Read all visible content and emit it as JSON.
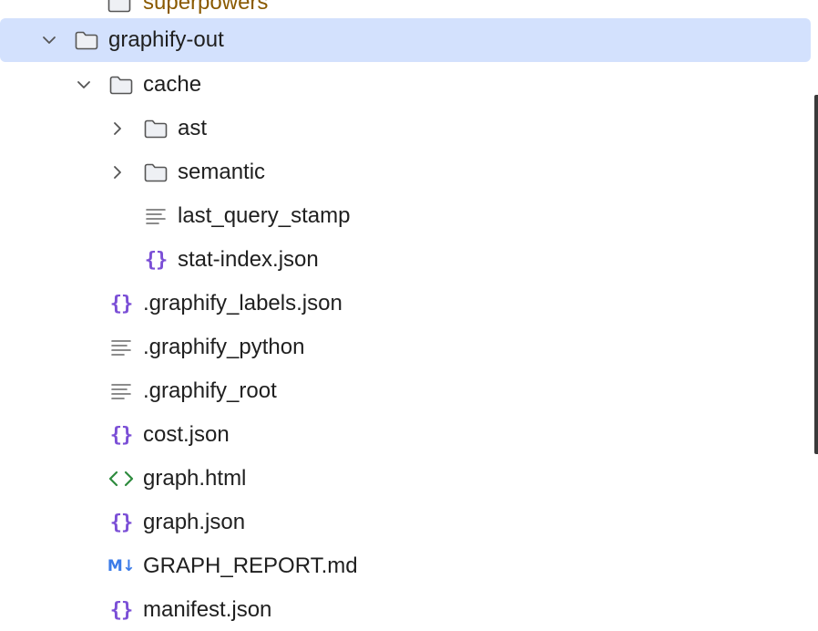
{
  "tree": {
    "items": [
      {
        "label": "superpowers",
        "kind": "folder",
        "expanded": false,
        "status": "modified"
      },
      {
        "label": "graphify-out",
        "kind": "folder",
        "expanded": true,
        "selected": true
      },
      {
        "label": "cache",
        "kind": "folder",
        "expanded": true
      },
      {
        "label": "ast",
        "kind": "folder",
        "expanded": false
      },
      {
        "label": "semantic",
        "kind": "folder",
        "expanded": false
      },
      {
        "label": "last_query_stamp",
        "kind": "text-file"
      },
      {
        "label": "stat-index.json",
        "kind": "json-file"
      },
      {
        "label": ".graphify_labels.json",
        "kind": "json-file"
      },
      {
        "label": ".graphify_python",
        "kind": "text-file"
      },
      {
        "label": ".graphify_root",
        "kind": "text-file"
      },
      {
        "label": "cost.json",
        "kind": "json-file"
      },
      {
        "label": "graph.html",
        "kind": "html-file"
      },
      {
        "label": "graph.json",
        "kind": "json-file"
      },
      {
        "label": "GRAPH_REPORT.md",
        "kind": "markdown-file"
      },
      {
        "label": "manifest.json",
        "kind": "json-file"
      }
    ]
  },
  "icons": {
    "json_glyph": "{}",
    "markdown_glyph": "M↓"
  },
  "colors": {
    "selection": "#d3e1fd",
    "json_icon": "#7b4fd6",
    "html_icon": "#2e8b3e",
    "markdown_icon": "#3b7be8",
    "modified_text": "#8a5a00"
  }
}
